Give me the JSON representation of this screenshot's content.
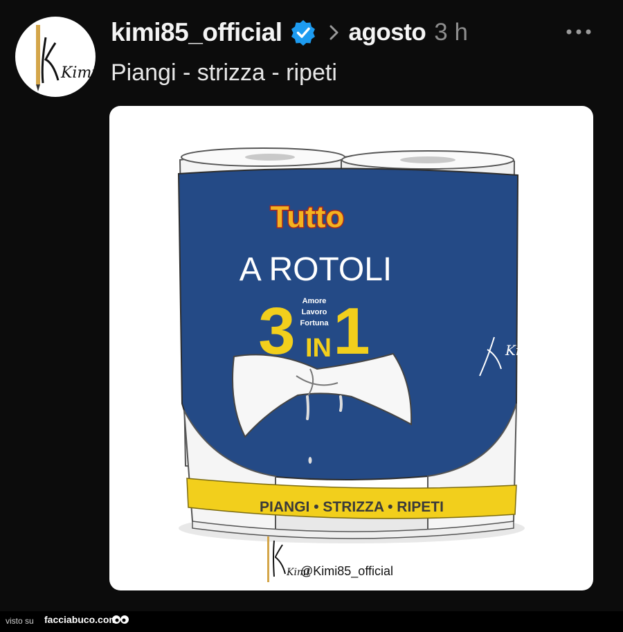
{
  "post": {
    "username": "kimi85_official",
    "group": "agosto",
    "time": "3 h",
    "caption": "Piangi - strizza - ripeti"
  },
  "image": {
    "brand": "Tutto",
    "title": "A ROTOLI",
    "big_left": "3",
    "big_right": "1",
    "in_text": "IN",
    "small_lines": [
      "Amore",
      "Lavoro",
      "Fortuna"
    ],
    "band_text": "PIANGI • STRIZZA • RIPETI",
    "signature": "Kimi",
    "handle": "@Kimi85_official",
    "avatar_text": "Kimi"
  },
  "footer": {
    "label": "visto su",
    "site": "facciabuco.com"
  },
  "colors": {
    "verified": "#1d9bf0",
    "package_blue": "#244a86",
    "band_yellow": "#f2cf1c",
    "brand_red": "#d0342c"
  }
}
